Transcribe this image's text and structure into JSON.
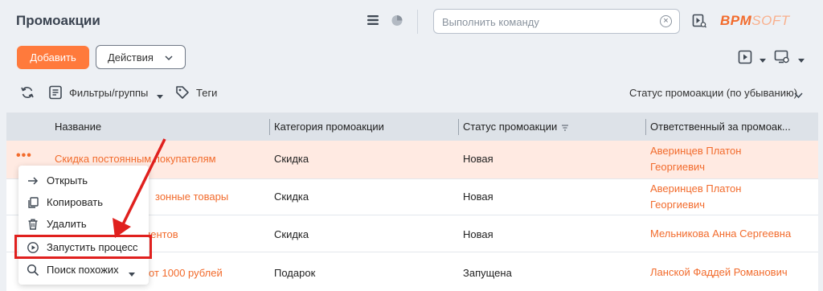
{
  "header": {
    "title": "Промоакции",
    "command_placeholder": "Выполнить команду",
    "logo_main": "BPM",
    "logo_sub": "SOFT",
    "icons": [
      "list-view-icon",
      "analytics-icon",
      "clear-icon",
      "video-help-icon"
    ]
  },
  "toolbar": {
    "add_label": "Добавить",
    "actions_label": "Действия",
    "icons": [
      "run-process-icon",
      "view-settings-icon"
    ]
  },
  "filter": {
    "filters_label": "Фильтры/группы",
    "tags_label": "Теги",
    "sort_label": "Статус промоакции (по убыванию)"
  },
  "grid": {
    "columns": [
      "Название",
      "Категория промоакции",
      "Статус промоакции",
      "Ответственный за промоак..."
    ],
    "rows": [
      {
        "name": "Скидка постоянным покупателям",
        "category": "Скидка",
        "status": "Новая",
        "responsible": "Аверинцев Платон Георгиевич"
      },
      {
        "name": "зонные товары",
        "category": "Скидка",
        "status": "Новая",
        "responsible": "Аверинцев Платон Георгиевич"
      },
      {
        "name": "иентов",
        "category": "Скидка",
        "status": "Новая",
        "responsible": "Мельникова Анна Сергеевна"
      },
      {
        "name": "от 1000 рублей",
        "category": "Подарок",
        "status": "Запущена",
        "responsible": "Ланской Фаддей Романович"
      }
    ]
  },
  "context_menu": {
    "items": [
      "Открыть",
      "Копировать",
      "Удалить",
      "Запустить процесс",
      "Поиск похожих"
    ]
  },
  "colors": {
    "accent": "#ff7a3c",
    "link": "#f26b2c",
    "highlight": "#e0201e"
  }
}
